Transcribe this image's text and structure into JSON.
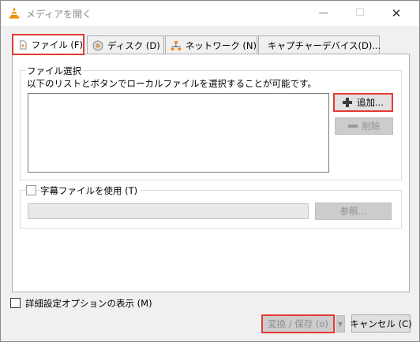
{
  "window": {
    "title": "メディアを開く",
    "minimize_glyph": "—",
    "maximize_glyph": "☐",
    "close_glyph": "✕"
  },
  "tabs": [
    {
      "label": "ファイル (F)",
      "icon": "file-play-icon",
      "active": true
    },
    {
      "label": "ディスク (D)",
      "icon": "disc-icon",
      "active": false
    },
    {
      "label": "ネットワーク (N)",
      "icon": "network-icon",
      "active": false
    },
    {
      "label": "キャプチャーデバイス(D)...",
      "icon": "capture-device-icon",
      "active": false
    }
  ],
  "file_selection": {
    "group_title": "ファイル選択",
    "description": "以下のリストとボタンでローカルファイルを選択することが可能です。",
    "add_label": "追加...",
    "remove_label": "削除"
  },
  "subtitle": {
    "checkbox_label": "字幕ファイルを使用 (T)",
    "browse_label": "参照..."
  },
  "footer": {
    "advanced_label": "詳細設定オプションの表示 (M)",
    "convert_label": "変換 / 保存 (o)",
    "dropdown_glyph": "▼",
    "cancel_label": "キャンセル (C)"
  },
  "colors": {
    "highlight": "#e53935",
    "vlc_orange": "#f18c05"
  }
}
